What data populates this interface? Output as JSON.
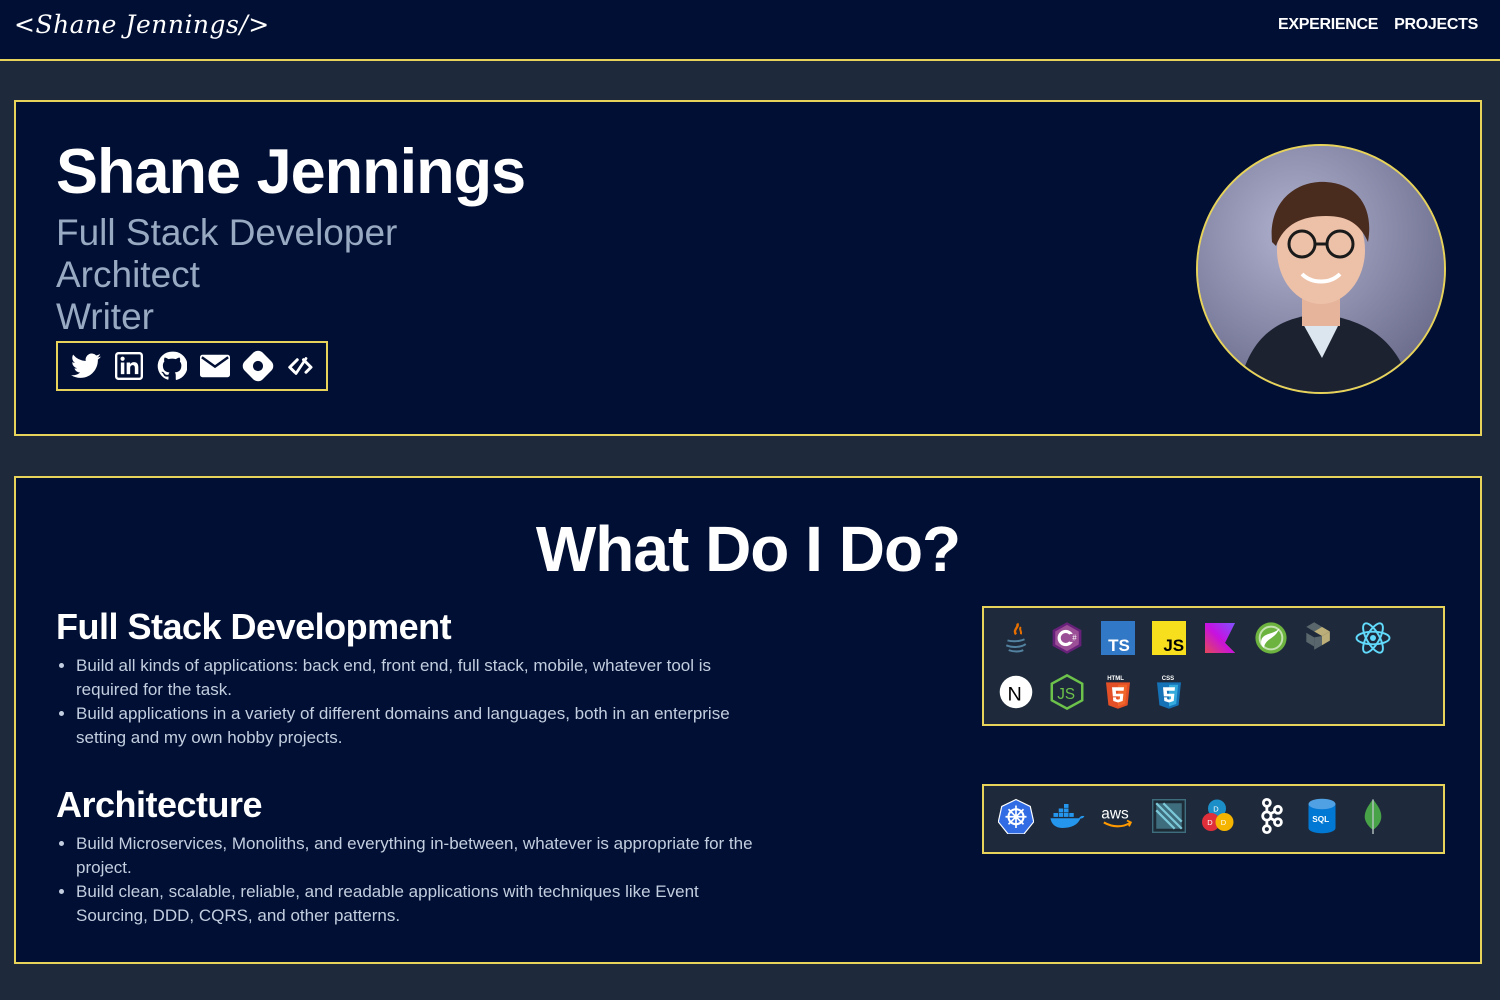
{
  "nav": {
    "logo": "<Shane Jennings/>",
    "links": [
      "EXPERIENCE",
      "PROJECTS"
    ]
  },
  "hero": {
    "name": "Shane Jennings",
    "roles": [
      "Full Stack Developer",
      "Architect",
      "Writer"
    ],
    "socials": [
      "twitter-icon",
      "linkedin-icon",
      "github-icon",
      "email-icon",
      "hashnode-icon",
      "devto-icon"
    ]
  },
  "what": {
    "title": "What Do I Do?",
    "services": [
      {
        "title": "Full Stack Development",
        "bullets": [
          "Build all kinds of applications: back end, front end, full stack, mobile, whatever tool is required for the task.",
          "Build applications in a variety of different domains and languages, both in an enterprise setting and my own hobby projects."
        ],
        "tech": [
          "java-icon",
          "csharp-icon",
          "typescript-icon",
          "javascript-icon",
          "kotlin-icon",
          "spring-icon",
          "hibernate-icon",
          "react-icon",
          "nextjs-icon",
          "nodejs-icon",
          "html5-icon",
          "css3-icon"
        ]
      },
      {
        "title": "Architecture",
        "bullets": [
          "Build Microservices, Monoliths, and everything in-between, whatever is appropriate for the project.",
          "Build clean, scalable, reliable, and readable applications with techniques like Event Sourcing, DDD, CQRS, and other patterns."
        ],
        "tech": [
          "kubernetes-icon",
          "docker-icon",
          "aws-icon",
          "circleci-icon",
          "dddd-icon",
          "kafka-icon",
          "sql-database-icon",
          "mongodb-icon"
        ]
      }
    ]
  },
  "labels": {
    "ts": "TS",
    "js": "JS",
    "n": "N",
    "aws": "aws",
    "html": "HTML",
    "css": "CSS",
    "sql": "SQL",
    "d": "D"
  },
  "colors": {
    "navy": "#000f33",
    "slate": "#1e2a3b",
    "gold": "#e7d35a",
    "muted": "#98a9c2"
  }
}
